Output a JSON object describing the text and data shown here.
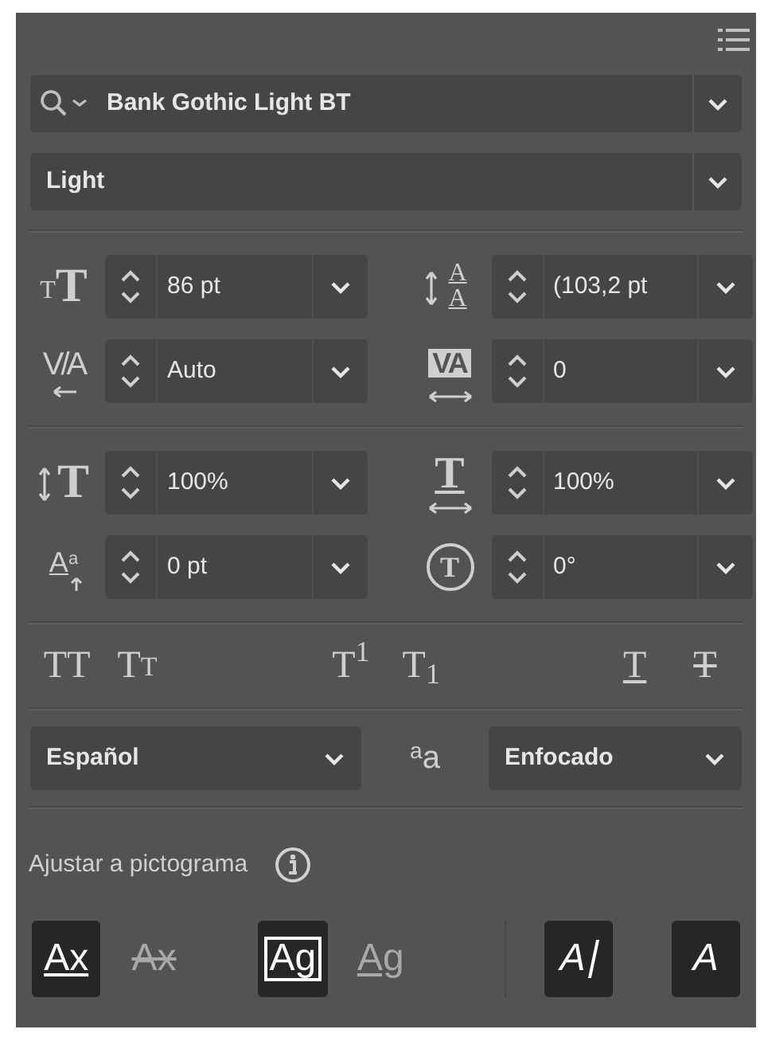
{
  "font_family": {
    "value": "Bank Gothic Light BT"
  },
  "font_style": {
    "value": "Light"
  },
  "field_groups": [
    [
      {
        "kind": "size",
        "symbol": "TT",
        "value": "86 pt"
      },
      {
        "kind": "leading",
        "symbol": "AA",
        "value": "(103,2 pt"
      },
      {
        "kind": "kerning",
        "symbol": "V/A",
        "value": "Auto"
      },
      {
        "kind": "tracking",
        "symbol": "VA",
        "value": "0"
      }
    ],
    [
      {
        "kind": "vscale",
        "symbol": "T",
        "value": "100%"
      },
      {
        "kind": "hscale",
        "symbol": "T",
        "value": "100%"
      },
      {
        "kind": "baseline",
        "symbol": "Aa",
        "value": "0 pt"
      },
      {
        "kind": "rotate",
        "symbol": "T",
        "value": "0°"
      }
    ]
  ],
  "style_buttons": [
    {
      "kind": "all_caps",
      "glyph": "TT"
    },
    {
      "kind": "small_caps",
      "glyph": "TT"
    },
    {
      "kind": "superscript",
      "glyph": "T$^{1}$"
    },
    {
      "kind": "subscript",
      "glyph": "T$_{1}$"
    },
    {
      "kind": "underline",
      "glyph": "T"
    },
    {
      "kind": "strikethrough",
      "glyph": "T"
    }
  ],
  "language": {
    "value": "Español"
  },
  "antialias": {
    "symbol": "aa",
    "value": "Enfocado"
  },
  "snap_label": "Ajustar a pictograma",
  "snap_buttons": [
    {
      "kind": "baseline",
      "glyph": "Ax",
      "selected": true
    },
    {
      "kind": "x_height",
      "glyph": "Ax",
      "selected": false
    },
    {
      "kind": "em_box",
      "glyph": "Ag",
      "selected": true
    },
    {
      "kind": "glyph_bounds",
      "glyph": "Ag",
      "selected": false
    },
    {
      "kind": "proximity",
      "glyph": "A",
      "selected": true
    },
    {
      "kind": "angular",
      "glyph": "A",
      "selected": true
    }
  ]
}
